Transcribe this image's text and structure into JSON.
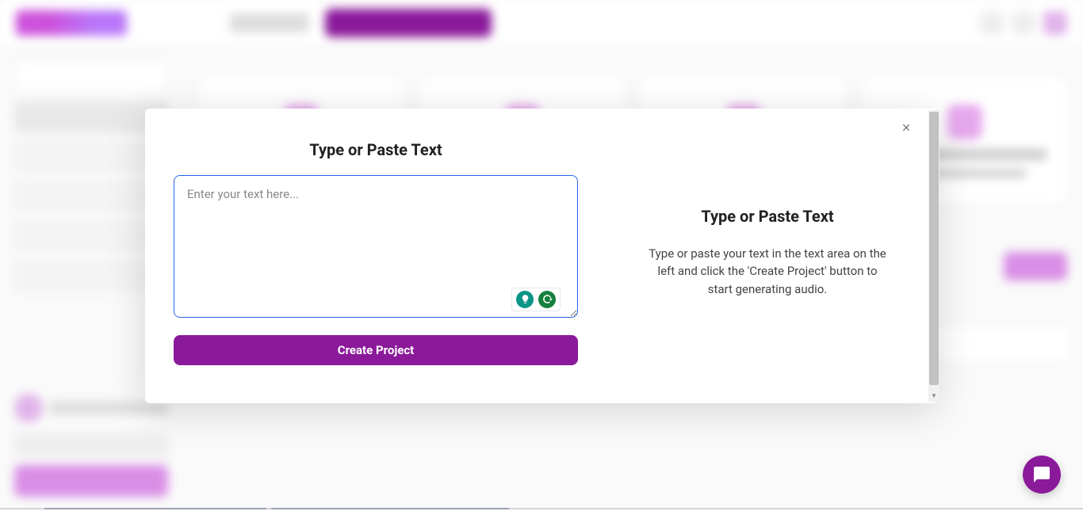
{
  "modal": {
    "left_title": "Type or Paste Text",
    "textarea_placeholder": "Enter your text here...",
    "create_button": "Create Project",
    "right_title": "Type or Paste Text",
    "right_description": "Type or paste your text in the text area on the left and click the 'Create Project' button to start generating audio."
  }
}
